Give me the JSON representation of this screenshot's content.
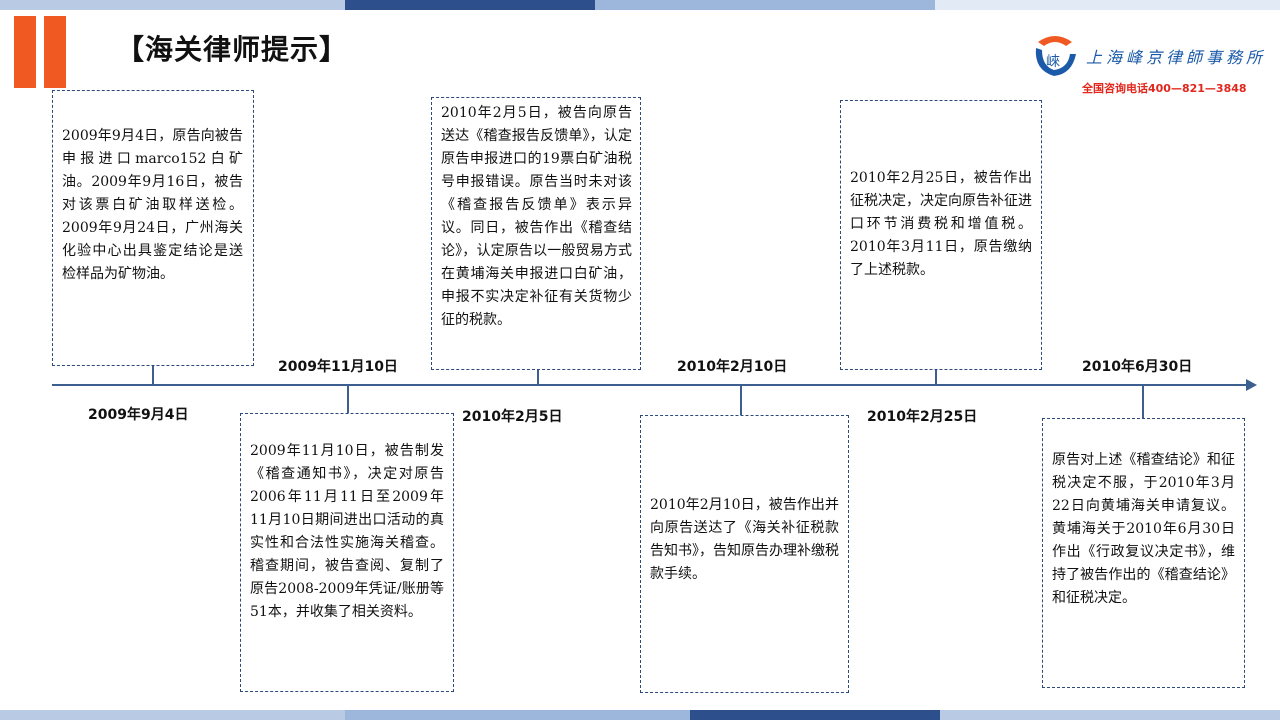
{
  "header": {
    "title": "【海关律师提示】"
  },
  "firm": {
    "name": "上海峰京律師事務所",
    "hotline": "全国咨询电话400—821—3848"
  },
  "timeline": {
    "dates": {
      "d1": "2009年9月4日",
      "d2": "2009年11月10日",
      "d3": "2010年2月5日",
      "d4": "2010年2月10日",
      "d5": "2010年2月25日",
      "d6": "2010年6月30日"
    },
    "events": {
      "e1": "2009年9月4日，原告向被告申报进口marco152白矿油。2009年9月16日，被告对该票白矿油取样送检。2009年9月24日，广州海关化验中心出具鉴定结论是送检样品为矿物油。",
      "e2": "2009年11月10日，被告制发《稽查通知书》，决定对原告2006年11月11日至2009年11月10日期间进出口活动的真实性和合法性实施海关稽查。稽查期间，被告查阅、复制了原告2008-2009年凭证/账册等51本，并收集了相关资料。",
      "e3": "2010年2月5日，被告向原告送达《稽查报告反馈单》，认定原告申报进口的19票白矿油税号申报错误。原告当时未对该《稽查报告反馈单》表示异议。同日，被告作出《稽查结论》，认定原告以一般贸易方式在黄埔海关申报进口白矿油，申报不实决定补征有关货物少征的税款。",
      "e4": "2010年2月10日，被告作出并向原告送达了《海关补征税款告知书》，告知原告办理补缴税款手续。",
      "e5": "2010年2月25日，被告作出征税决定，决定向原告补征进口环节消费税和增值税。2010年3月11日，原告缴纳了上述税款。",
      "e6": "原告对上述《稽查结论》和征税决定不服，于2010年3月22日向黄埔海关申请复议。黄埔海关于2010年6月30日作出《行政复议决定书》，维持了被告作出的《稽查结论》和征税决定。"
    }
  },
  "colors": {
    "accent_orange": "#f05a22",
    "axis_blue": "#3d5f8f",
    "firm_blue": "#1b5aa8",
    "hotline_red": "#e2261c"
  }
}
